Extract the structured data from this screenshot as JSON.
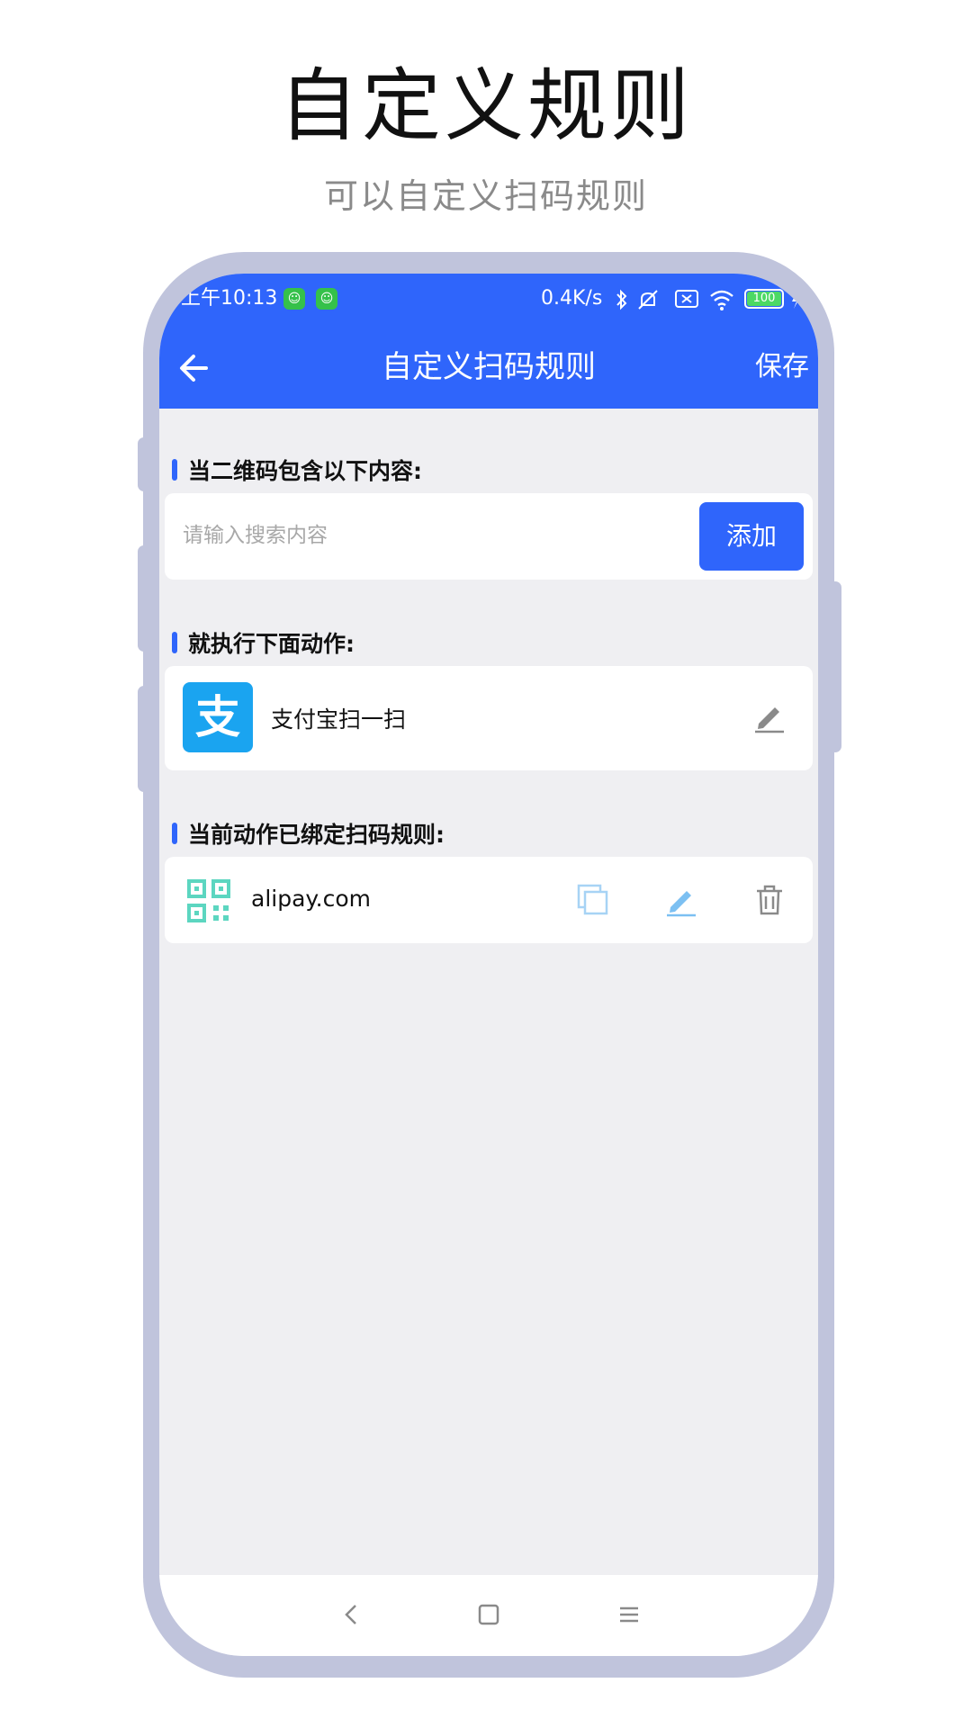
{
  "hero": {
    "title": "自定义规则",
    "subtitle": "可以自定义扫码规则"
  },
  "status_bar": {
    "time": "上午10:13",
    "network_speed": "0.4K/s",
    "battery": "100",
    "icons": [
      "app-notification-icon",
      "app-notification-icon",
      "bluetooth-icon",
      "mute-icon",
      "sim-icon",
      "wifi-icon",
      "battery-icon",
      "charging-icon"
    ]
  },
  "nav": {
    "title": "自定义扫码规则",
    "save_label": "保存",
    "back_icon": "back-arrow-icon"
  },
  "condition_section": {
    "heading": "当二维码包含以下内容:",
    "search_placeholder": "请输入搜索内容",
    "search_value": "",
    "add_label": "添加"
  },
  "action_section": {
    "heading": "就执行下面动作:",
    "logo_glyph": "支",
    "action_name": "支付宝扫一扫",
    "edit_icon": "pencil-icon"
  },
  "rules_section": {
    "heading": "当前动作已绑定扫码规则:",
    "rules": [
      {
        "text": "alipay.com",
        "icons": [
          "qr-code-icon",
          "copy-icon",
          "edit-icon",
          "delete-icon"
        ]
      }
    ]
  },
  "bottom_nav": {
    "keys": [
      "back-key-icon",
      "home-key-icon",
      "menu-key-icon"
    ]
  },
  "colors": {
    "accent": "#2f65fb",
    "page_bg": "#efeff2",
    "phone_frame": "#c0c4dc",
    "alipay_blue": "#1aa4f0",
    "qr_teal": "#5cd6c0"
  }
}
